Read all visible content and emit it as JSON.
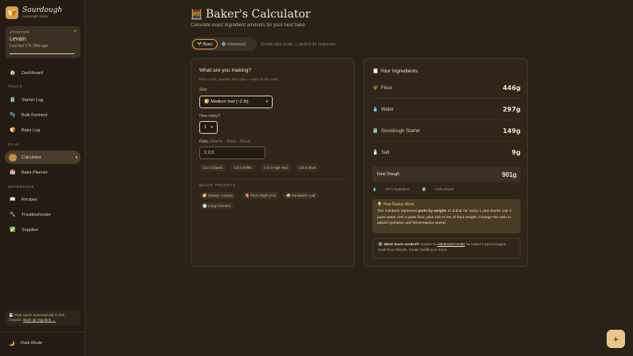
{
  "brand": {
    "name": "Sourdough",
    "sub": "corkenplit studio",
    "logo_icon": "bread-icon"
  },
  "starter": {
    "label": "STARTER",
    "name": "Levain",
    "last_fed": "Last fed 17h 39m ago",
    "close": "×",
    "progress": 0.96
  },
  "nav": {
    "dashboard": "Dashboard",
    "track_header": "TRACK",
    "starter_log": "Starter Log",
    "bulk_ferment": "Bulk Ferment",
    "bake_log": "Bake Log",
    "plan_header": "PLAN",
    "calculator": "Calculator",
    "bake_planner": "Bake Planner",
    "reference_header": "REFERENCE",
    "recipes": "Recipes",
    "troubleshooter": "Troubleshooter",
    "supplies": "Supplies"
  },
  "icons": {
    "dashboard": "🏠",
    "starter_log": "🫙",
    "bulk_ferment": "🫧",
    "bake_log": "🍞",
    "calculator": "🧮",
    "bake_planner": "📅",
    "recipes": "📖",
    "troubleshooter": "🔧",
    "supplies": "✅",
    "dark_mode": "🌙",
    "title": "🧮",
    "basic": "🌱",
    "advanced": "⚙️",
    "size": "🍞",
    "ingredients": "📋",
    "flour": "🌾",
    "water": "💧",
    "starter": "🫙",
    "salt": "🧂",
    "hydration": "💧",
    "starter_pct": "🫙",
    "bulb": "💡",
    "gear": "⚙️",
    "classic": "🍞",
    "pizza": "🍕",
    "sandwich": "🥪",
    "long": "🕐",
    "save": "💾"
  },
  "save_note": {
    "text": "Data saves automatically in this browser.",
    "link": "Back up regularly →"
  },
  "dark_mode": "Dark Mode",
  "page": {
    "title": "Baker's Calculator",
    "subtitle": "Calculate exact ingredient amounts for your next bake."
  },
  "mode": {
    "basic": "Basic",
    "advanced": "Advanced",
    "hint": "Simple ratio mode — perfect for beginners"
  },
  "form": {
    "title": "What are you making?",
    "hint": "Pick a size, quantity and ratio — we'll do the math.",
    "size_label": "Size",
    "size_value": "Medium loaf (~2 lb)",
    "count_label": "How many?",
    "count_value": "1",
    "ratio_label": "Ratio",
    "ratio_hint": "(Starter : Water : Flour)",
    "ratio_value": "1:2:3",
    "ratio_chips": [
      "1:2:3 Classic",
      "1:2:4 Stiffer",
      "1:3:4 High Hyd",
      "1:5:5 Slow"
    ],
    "presets_label": "QUICK PRESETS",
    "presets": [
      "Classic Country",
      "Pizza Night (×4)",
      "Sandwich Loaf",
      "Long Ferment"
    ]
  },
  "ingredients": {
    "title": "Your Ingredients",
    "flour_label": "Flour",
    "flour": "446g",
    "water_label": "Water",
    "water": "297g",
    "starter_label": "Sourdough Starter",
    "starter": "149g",
    "salt_label": "Salt",
    "salt": "9g",
    "total_label": "Total Dough",
    "total": "901g",
    "hydration": "~67% hydration",
    "starter_pct": "~33% starter"
  },
  "how": {
    "title": "How Ratios Work",
    "p1": "The numbers represent ",
    "bold1": "parts by weight",
    "p2": ". In ",
    "bold2": "1:2:3",
    "p3": ", for every 1 part starter use 2 parts water and 3 parts flour, plus salt at 2% of flour weight. Change the ratio to adjust hydration and fermentation speed."
  },
  "more": {
    "bold": "Want more control?",
    "p1": " Switch to ",
    "link": "Advanced mode",
    "p2": " for baker's percentages, multi-flour blends, levain building & more."
  },
  "fab": "+"
}
